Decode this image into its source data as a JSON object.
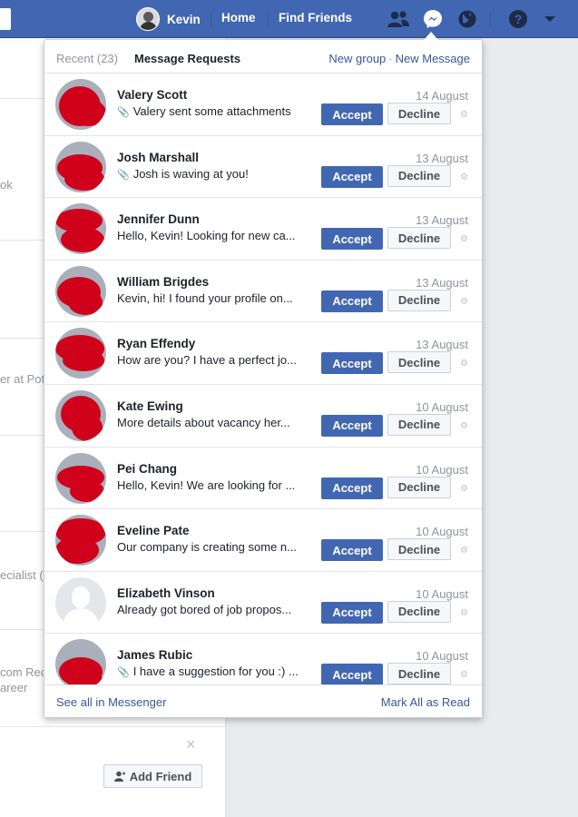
{
  "topbar": {
    "user_name": "Kevin",
    "home_label": "Home",
    "find_friends_label": "Find Friends",
    "bg_color": "#4267b2"
  },
  "background_page": {
    "fragments": [
      "ok",
      "er at Pot",
      "ecialist (",
      "com Rec",
      "areer"
    ],
    "close_glyph": "×",
    "add_friend_label": "Add Friend"
  },
  "flyout": {
    "tab_recent": "Recent (23)",
    "tab_requests": "Message Requests",
    "new_group": "New group",
    "separator": "·",
    "new_message": "New Message",
    "accept_label": "Accept",
    "decline_label": "Decline",
    "gear_glyph": "⚙",
    "see_all": "See all in Messenger",
    "mark_all": "Mark All as Read",
    "requests": [
      {
        "name": "Valery Scott",
        "snippet": "Valery sent some attachments",
        "date": "14 August",
        "attachment": true
      },
      {
        "name": "Josh Marshall",
        "snippet": "Josh is waving at you!",
        "date": "13 August",
        "attachment": true
      },
      {
        "name": "Jennifer Dunn",
        "snippet": "Hello, Kevin! Looking for new ca...",
        "date": "13 August",
        "attachment": false
      },
      {
        "name": "William Brigdes",
        "snippet": "Kevin, hi! I found your profile on...",
        "date": "13 August",
        "attachment": false
      },
      {
        "name": "Ryan Effendy",
        "snippet": "How are you? I have a perfect jo...",
        "date": "13 August",
        "attachment": false
      },
      {
        "name": "Kate Ewing",
        "snippet": "More details about vacancy her...",
        "date": "10 August",
        "attachment": false
      },
      {
        "name": "Pei Chang",
        "snippet": "Hello, Kevin! We are looking for ...",
        "date": "10 August",
        "attachment": false
      },
      {
        "name": "Eveline Pate",
        "snippet": "Our company is creating some n...",
        "date": "10 August",
        "attachment": false
      },
      {
        "name": "Elizabeth Vinson",
        "snippet": "Already got bored of job propos...",
        "date": "10 August",
        "attachment": false
      },
      {
        "name": "James Rubic",
        "snippet": "I have a suggestion for you :) ...",
        "date": "10 August",
        "attachment": true
      }
    ]
  }
}
